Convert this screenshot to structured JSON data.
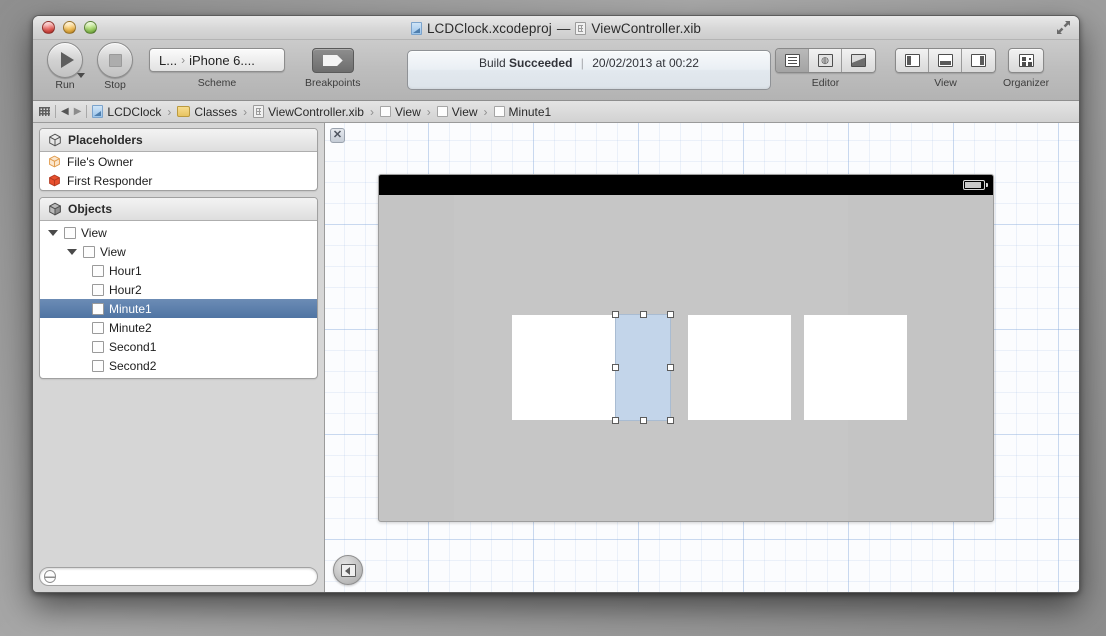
{
  "window": {
    "title": "LCDClock.xcodeproj — ViewController.xib",
    "title_project": "LCDClock.xcodeproj",
    "title_dash": "—",
    "title_file": "ViewController.xib",
    "traffic_lights": [
      "close",
      "minimize",
      "zoom"
    ],
    "fullscreen_icon": "fullscreen-arrows-icon"
  },
  "toolbar": {
    "run_label": "Run",
    "stop_label": "Stop",
    "scheme_label": "Scheme",
    "scheme_value_project": "L...",
    "scheme_value_device": "iPhone 6....",
    "scheme_separator": "›",
    "breakpoints_label": "Breakpoints",
    "editor_label": "Editor",
    "view_label": "View",
    "organizer_label": "Organizer",
    "status": {
      "prefix": "Build",
      "result": "Succeeded",
      "separator": "|",
      "timestamp": "20/02/2013 at 00:22"
    },
    "editor_segments": [
      "standard-editor-icon",
      "assistant-editor-icon",
      "version-editor-icon"
    ],
    "view_segments": [
      "hide-navigator-icon",
      "hide-debug-area-icon",
      "hide-utilities-icon"
    ],
    "organizer_icon": "organizer-icon"
  },
  "jumpbar": {
    "grid_icon": "related-items-icon",
    "back_arrow": "◀",
    "forward_arrow": "▶",
    "separator": "›",
    "crumbs": [
      {
        "label": "LCDClock",
        "icon": "project-icon"
      },
      {
        "label": "Classes",
        "icon": "folder-icon"
      },
      {
        "label": "ViewController.xib",
        "icon": "xib-icon"
      },
      {
        "label": "View",
        "icon": "view-icon"
      },
      {
        "label": "View",
        "icon": "view-icon"
      },
      {
        "label": "Minute1",
        "icon": "view-icon"
      }
    ]
  },
  "navigator": {
    "placeholders": {
      "title": "Placeholders",
      "icon": "wireframe-cube-icon",
      "items": [
        {
          "label": "File's Owner",
          "icon": "files-owner-icon"
        },
        {
          "label": "First Responder",
          "icon": "first-responder-icon"
        }
      ]
    },
    "objects": {
      "title": "Objects",
      "icon": "solid-cube-icon",
      "items": [
        {
          "label": "View",
          "indent": 0,
          "twisty": "expanded",
          "selected": false
        },
        {
          "label": "View",
          "indent": 1,
          "twisty": "expanded",
          "selected": false
        },
        {
          "label": "Hour1",
          "indent": 2,
          "twisty": "none",
          "selected": false
        },
        {
          "label": "Hour2",
          "indent": 2,
          "twisty": "none",
          "selected": false
        },
        {
          "label": "Minute1",
          "indent": 2,
          "twisty": "none",
          "selected": true
        },
        {
          "label": "Minute2",
          "indent": 2,
          "twisty": "none",
          "selected": false
        },
        {
          "label": "Second1",
          "indent": 2,
          "twisty": "none",
          "selected": false
        },
        {
          "label": "Second2",
          "indent": 2,
          "twisty": "none",
          "selected": false
        }
      ]
    },
    "filter_placeholder": ""
  },
  "canvas": {
    "close_glyph": "✕",
    "outline_button_icon": "show-document-outline-icon",
    "battery_icon": "battery-icon",
    "selected_object": "Minute1",
    "handles": 8
  },
  "colors": {
    "selection_blue": "#c3d5ea",
    "row_selection": "#4f74a3",
    "grid_line": "#78a0d7",
    "device_gray": "#c4c4c4",
    "inner_view_gray": "#c6c6c6",
    "digit_white": "#ffffff",
    "statusbar_black": "#000000"
  }
}
